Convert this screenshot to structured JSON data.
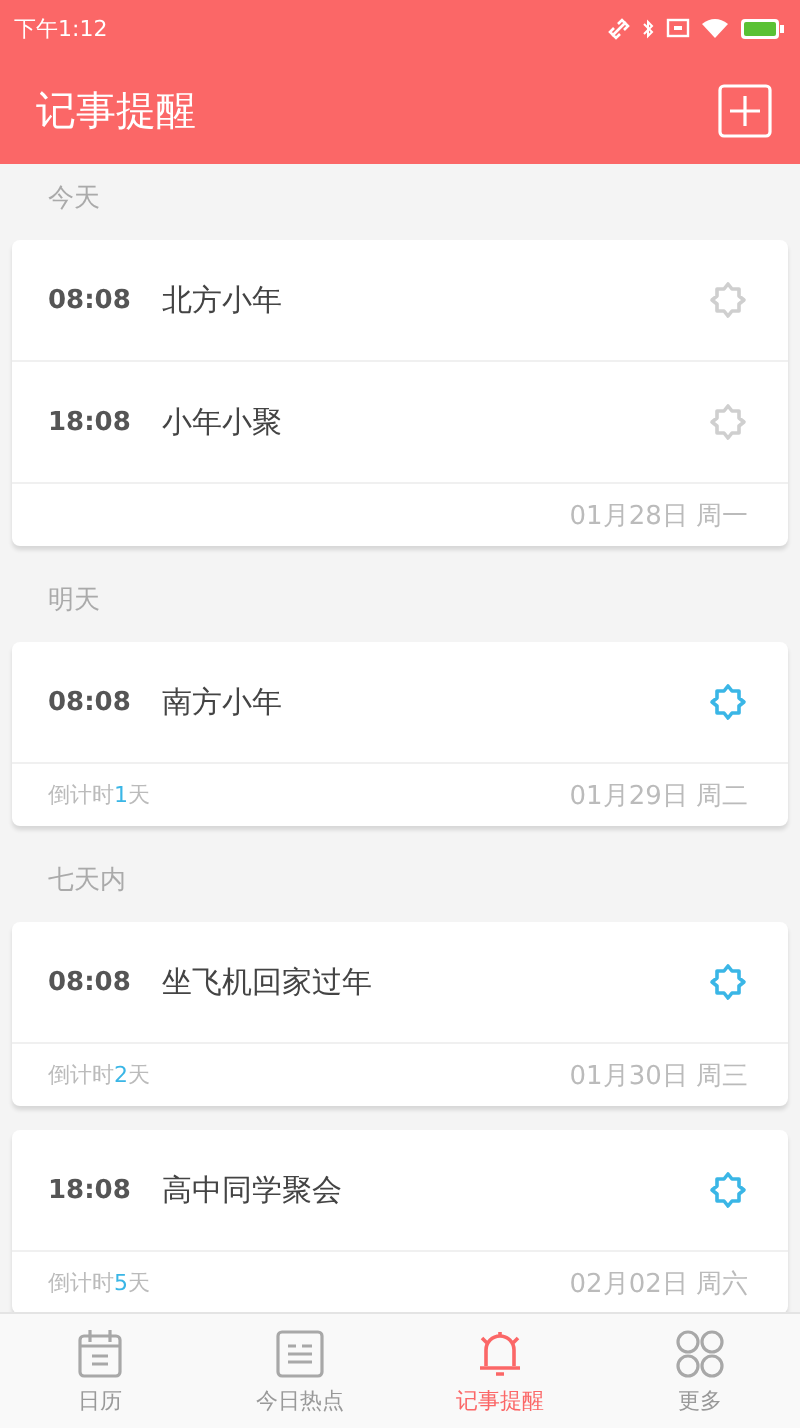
{
  "status_bar": {
    "time": "下午1:12"
  },
  "header": {
    "title": "记事提醒"
  },
  "sections": [
    {
      "label": "今天",
      "cards": [
        {
          "events": [
            {
              "time": "08:08",
              "title": "北方小年",
              "alarm_on": false
            },
            {
              "time": "18:08",
              "title": "小年小聚",
              "alarm_on": false
            }
          ],
          "date": "01月28日 周一"
        }
      ]
    },
    {
      "label": "明天",
      "cards": [
        {
          "events": [
            {
              "time": "08:08",
              "title": "南方小年",
              "alarm_on": true
            }
          ],
          "countdown": {
            "prefix": "倒计时",
            "days": "1",
            "suffix": "天"
          },
          "date": "01月29日 周二"
        }
      ]
    },
    {
      "label": "七天内",
      "cards": [
        {
          "events": [
            {
              "time": "08:08",
              "title": "坐飞机回家过年",
              "alarm_on": true
            }
          ],
          "countdown": {
            "prefix": "倒计时",
            "days": "2",
            "suffix": "天"
          },
          "date": "01月30日 周三"
        },
        {
          "events": [
            {
              "time": "18:08",
              "title": "高中同学聚会",
              "alarm_on": true
            }
          ],
          "countdown": {
            "prefix": "倒计时",
            "days": "5",
            "suffix": "天"
          },
          "date": "02月02日 周六"
        }
      ]
    }
  ],
  "tabs": [
    {
      "label": "日历",
      "kind": "calendar",
      "selected": false
    },
    {
      "label": "今日热点",
      "kind": "news",
      "selected": false
    },
    {
      "label": "记事提醒",
      "kind": "bell",
      "selected": true
    },
    {
      "label": "更多",
      "kind": "grid",
      "selected": false
    }
  ]
}
